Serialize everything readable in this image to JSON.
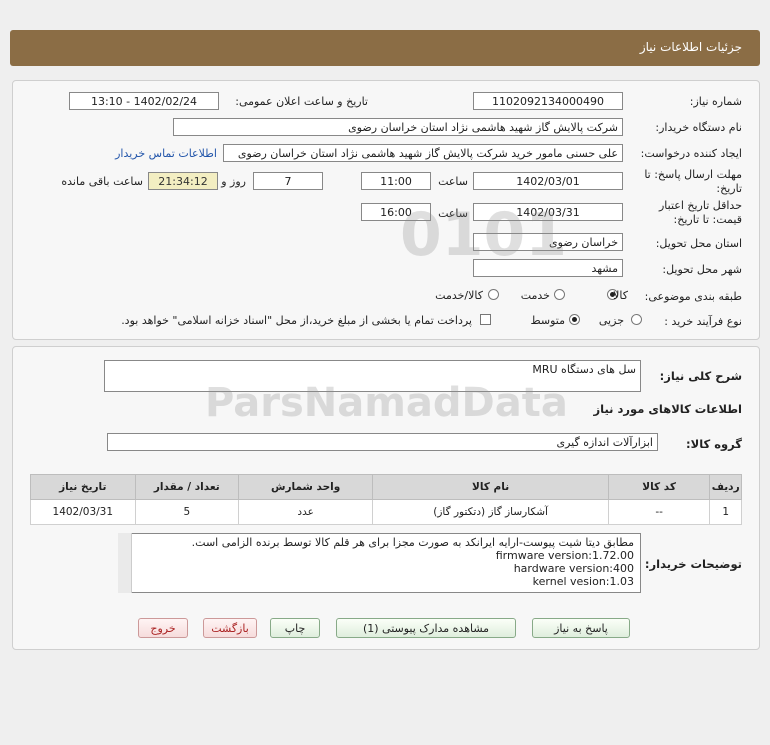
{
  "header": {
    "title": "جزئیات اطلاعات نیاز"
  },
  "form": {
    "need_number_label": "شماره نیاز:",
    "need_number": "1102092134000490",
    "announce_label": "تاریخ و ساعت اعلان عمومی:",
    "announce_value": "1402/02/24 - 13:10",
    "buyer_label": "نام دستگاه خریدار:",
    "buyer_value": "شرکت پالایش گاز شهید هاشمی نژاد   استان خراسان رضوی",
    "creator_label": "ایجاد کننده درخواست:",
    "creator_value": "علی حسنی مامور خرید شرکت پالایش گاز شهید هاشمی نژاد   استان خراسان رضوی",
    "contact_link": "اطلاعات تماس خریدار",
    "deadline_label1": "مهلت ارسال پاسخ: تا",
    "deadline_label2": "تاریخ:",
    "deadline_date": "1402/03/01",
    "time_label": "ساعت",
    "deadline_time": "11:00",
    "days_value": "7",
    "days_label": "روز و",
    "remain_value": "21:34:12",
    "remain_label": "ساعت باقی مانده",
    "validity_label1": "حداقل تاریخ اعتبار",
    "validity_label2": "قیمت: تا تاریخ:",
    "validity_date": "1402/03/31",
    "validity_time_label": "ساعت",
    "validity_time": "16:00",
    "province_label": "استان محل تحویل:",
    "province_value": "خراسان رضوی",
    "city_label": "شهر محل تحویل:",
    "city_value": "مشهد",
    "category_label": "طبقه بندی موضوعی:",
    "category_options": [
      "کالا",
      "خدمت",
      "کالا/خدمت"
    ],
    "process_label": "نوع فرآیند خرید :",
    "process_options": [
      "جزیی",
      "متوسط"
    ],
    "payment_note": "پرداخت تمام یا بخشی از مبلغ خرید،از محل \"اسناد خزانه اسلامی\" خواهد بود."
  },
  "summary": {
    "desc_label": "شرح کلی نیاز:",
    "desc_value": "سل های دستگاه MRU",
    "goods_info_title": "اطلاعات کالاهای مورد نیاز",
    "group_label": "گروه کالا:",
    "group_value": "ابزارآلات اندازه گیری"
  },
  "table": {
    "headers": [
      "ردیف",
      "کد کالا",
      "نام کالا",
      "واحد شمارش",
      "تعداد / مقدار",
      "تاریخ نیاز"
    ],
    "rows": [
      [
        "1",
        "--",
        "آشکارساز گاز (دتکتور گاز)",
        "عدد",
        "5",
        "1402/03/31"
      ]
    ]
  },
  "notes": {
    "label": "توضیحات خریدار:",
    "lines": [
      "مطابق دیتا شیت پیوست-ارایه ایرانکد به صورت مجزا برای هر قلم کالا توسط برنده الزامی است.",
      "firmware version:1.72.00",
      "hardware version:400",
      "kernel vesion:1.03"
    ]
  },
  "buttons": {
    "reply": "پاسخ به نیاز",
    "attachments": "مشاهده مدارک پیوستی (1)",
    "print": "چاپ",
    "back": "بازگشت",
    "exit": "خروج"
  }
}
